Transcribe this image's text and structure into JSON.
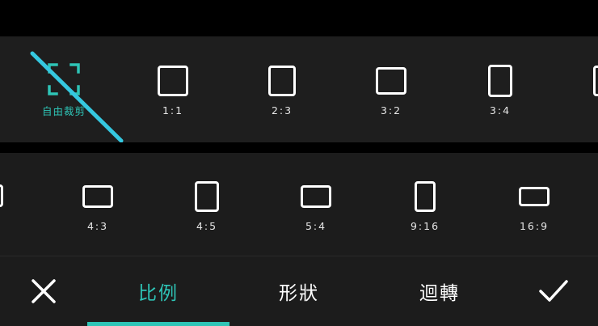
{
  "ratios_row1": [
    {
      "label": "自由裁剪",
      "icon": "free-crop-icon",
      "active": true
    },
    {
      "label": "1:1",
      "icon": "square-icon"
    },
    {
      "label": "2:3",
      "icon": "portrait-2-3-icon"
    },
    {
      "label": "3:2",
      "icon": "landscape-3-2-icon"
    },
    {
      "label": "3:4",
      "icon": "portrait-3-4-icon"
    }
  ],
  "ratios_row2": [
    {
      "label": "4:3",
      "icon": "landscape-4-3-icon"
    },
    {
      "label": "4:5",
      "icon": "portrait-4-5-icon"
    },
    {
      "label": "5:4",
      "icon": "landscape-5-4-icon"
    },
    {
      "label": "9:16",
      "icon": "portrait-9-16-icon"
    },
    {
      "label": "16:9",
      "icon": "landscape-16-9-icon"
    }
  ],
  "tabs": [
    {
      "label": "比例",
      "active": true
    },
    {
      "label": "形狀",
      "active": false
    },
    {
      "label": "迴轉",
      "active": false
    }
  ],
  "actions": {
    "cancel_icon": "close-icon",
    "confirm_icon": "check-icon"
  },
  "colors": {
    "accent": "#2ec4b6",
    "strike": "#35c8e0",
    "panel": "#1e1e1e",
    "foreground": "#ffffff"
  }
}
